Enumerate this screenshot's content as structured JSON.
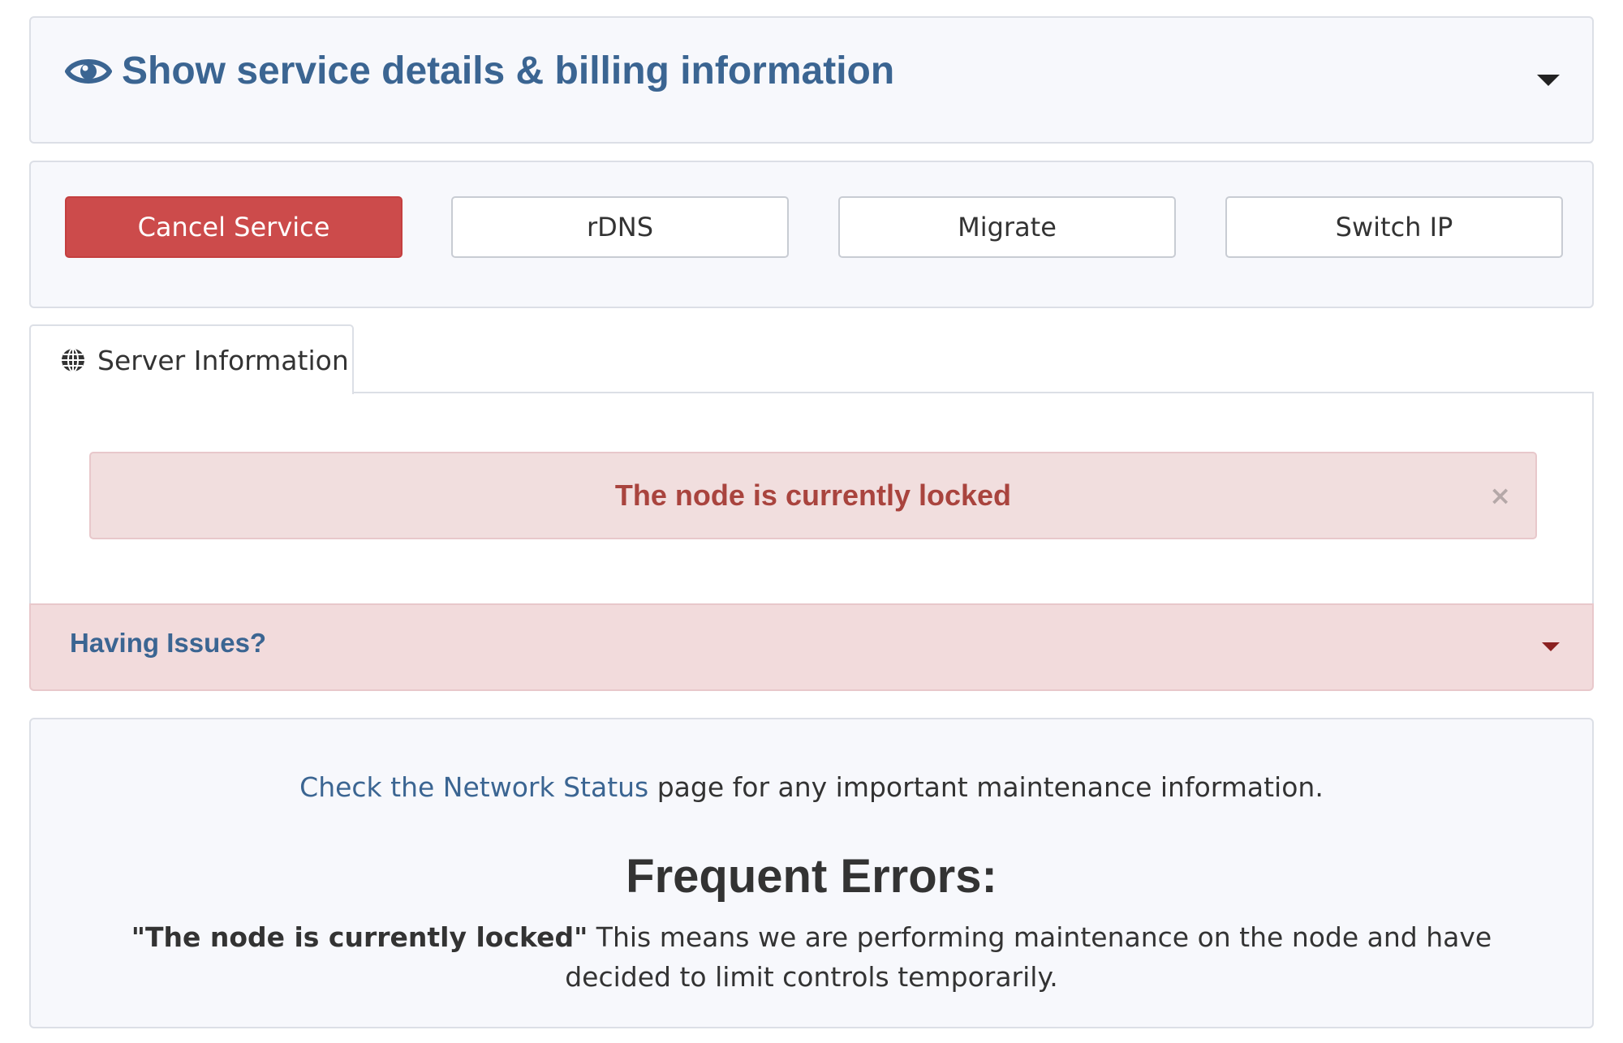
{
  "details": {
    "title": "Show service details & billing information",
    "icon": "eye-icon",
    "accent_color": "#3b6592"
  },
  "actions": {
    "cancel_label": "Cancel Service",
    "rdns_label": "rDNS",
    "migrate_label": "Migrate",
    "switch_ip_label": "Switch IP",
    "cancel_color": "#cc4b4b"
  },
  "tabs": [
    {
      "label": "Server Information",
      "icon": "globe-icon",
      "active": true
    }
  ],
  "alert": {
    "message": "The node is currently locked",
    "close_symbol": "×",
    "text_color": "#a9443e",
    "background": "#f1dede"
  },
  "issues": {
    "title": "Having Issues?"
  },
  "info": {
    "link_text": "Check the Network Status",
    "line_rest": " page for any important maintenance information.",
    "frequent_title": "Frequent Errors:",
    "error_quote": "\"The node is currently locked\"",
    "error_explanation": " This means we are performing maintenance on the node and have decided to limit controls temporarily."
  }
}
